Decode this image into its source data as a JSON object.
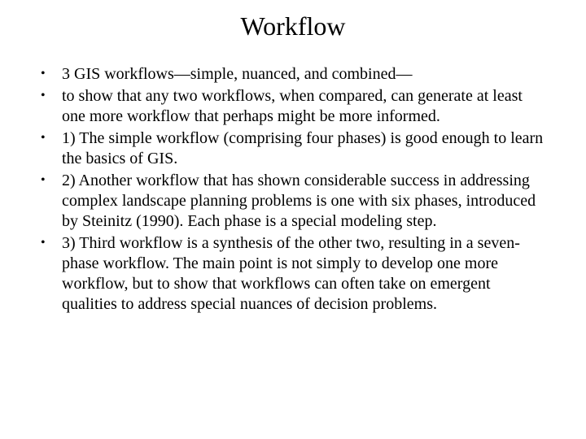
{
  "slide": {
    "title": "Workflow",
    "bullets": [
      "3 GIS workflows—simple, nuanced, and combined—",
      "to show that any two workflows, when compared, can generate at least one more workflow that perhaps might be more informed.",
      "1) The simple workflow (comprising four phases) is good enough to learn the basics of GIS.",
      "2) Another workflow that has shown considerable success in addressing complex landscape planning problems is one with six phases, introduced by Steinitz (1990). Each phase is a special modeling step.",
      "3) Third workflow is a synthesis of the other two, resulting in a seven-phase workflow. The main point is not simply to develop one more workflow, but to show that workflows can often take on emergent qualities to address special nuances of decision problems."
    ]
  }
}
